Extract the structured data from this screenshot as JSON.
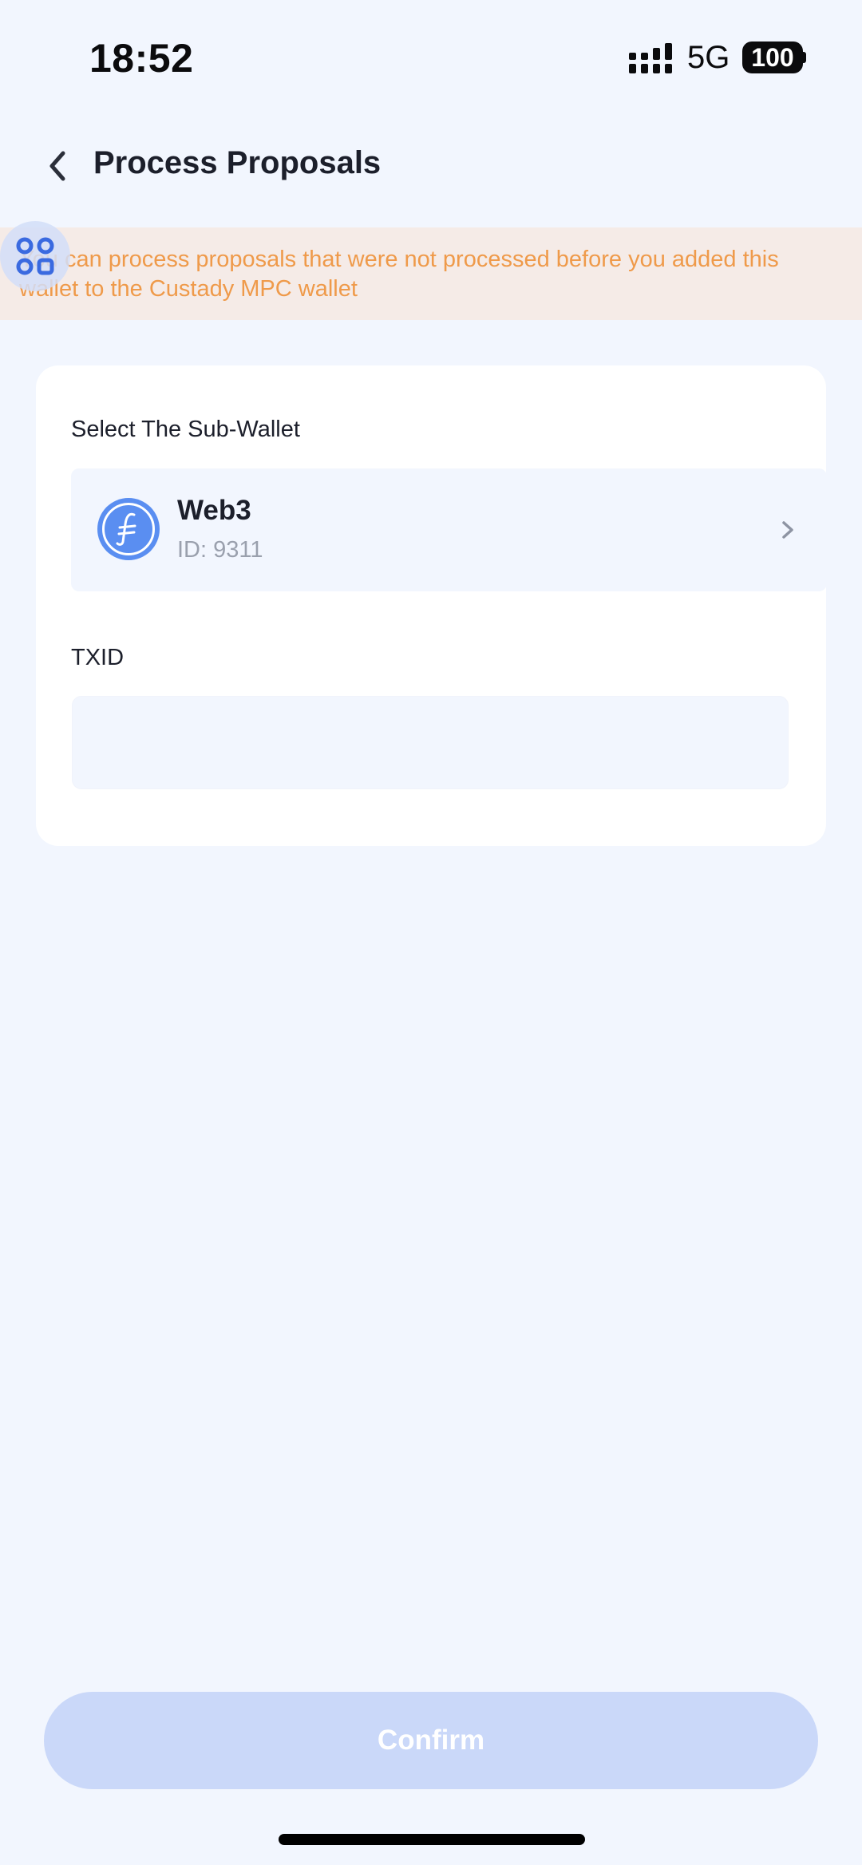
{
  "status_bar": {
    "time": "18:52",
    "network": "5G",
    "battery": "100",
    "icons": [
      "signal-icon",
      "battery-icon"
    ]
  },
  "header": {
    "title": "Process Proposals",
    "back_icon": "chevron-left-icon"
  },
  "notice": {
    "text": "You can process proposals that were not processed before you added this wallet to the Custady MPC wallet",
    "color": "#ef9a4a",
    "background": "#f5ebe7"
  },
  "floating_button": {
    "icon": "grid-apps-icon"
  },
  "form": {
    "sub_wallet_label": "Select The Sub-Wallet",
    "wallet": {
      "name": "Web3",
      "id": "ID: 9311",
      "icon": "filecoin-icon",
      "chevron_icon": "chevron-right-icon"
    },
    "txid_label": "TXID",
    "txid_value": ""
  },
  "confirm": {
    "label": "Confirm"
  },
  "colors": {
    "background": "#f2f6fe",
    "accent": "#5a8ef1",
    "confirm_disabled": "#cad8f9"
  }
}
